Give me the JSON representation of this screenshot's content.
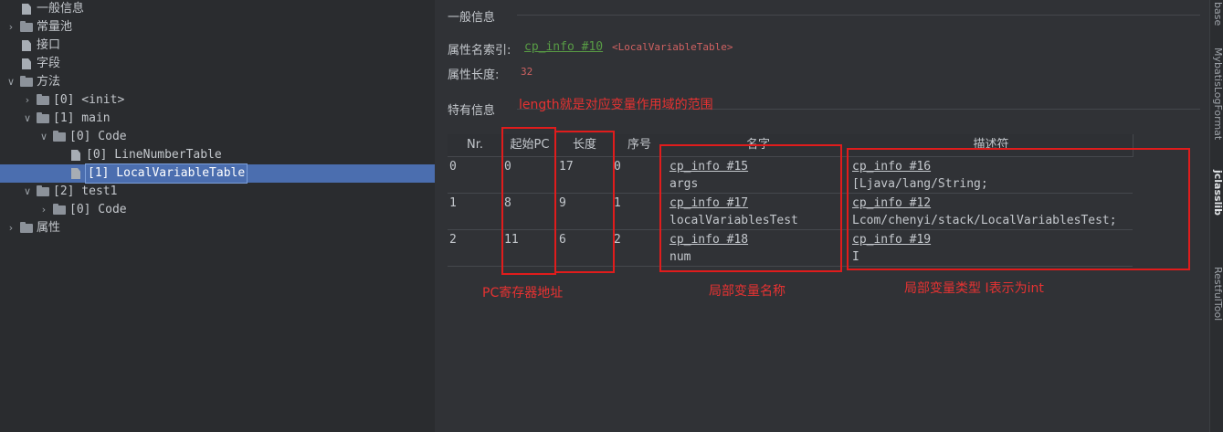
{
  "tree": [
    {
      "label": "一般信息",
      "icon": "file",
      "depth": 0,
      "chev": ""
    },
    {
      "label": "常量池",
      "icon": "folder",
      "depth": 0,
      "chev": "›"
    },
    {
      "label": "接口",
      "icon": "file",
      "depth": 0,
      "chev": ""
    },
    {
      "label": "字段",
      "icon": "file",
      "depth": 0,
      "chev": ""
    },
    {
      "label": "方法",
      "icon": "folder",
      "depth": 0,
      "chev": "⌄"
    },
    {
      "label": "[0] <init>",
      "icon": "folder",
      "depth": 1,
      "chev": "›"
    },
    {
      "label": "[1] main",
      "icon": "folder",
      "depth": 1,
      "chev": "⌄"
    },
    {
      "label": "[0] Code",
      "icon": "folder",
      "depth": 2,
      "chev": "⌄"
    },
    {
      "label": "[0] LineNumberTable",
      "icon": "file",
      "depth": 3,
      "chev": ""
    },
    {
      "label": "[1] LocalVariableTable",
      "icon": "file",
      "depth": 3,
      "chev": "",
      "selected": true
    },
    {
      "label": "[2] test1",
      "icon": "folder",
      "depth": 1,
      "chev": "⌄"
    },
    {
      "label": "[0] Code",
      "icon": "folder",
      "depth": 2,
      "chev": "›"
    },
    {
      "label": "属性",
      "icon": "folder",
      "depth": 0,
      "chev": "›"
    }
  ],
  "general": {
    "title": "一般信息",
    "name_index_label": "属性名索引:",
    "name_index_link": "cp_info #10",
    "name_index_value": "<LocalVariableTable>",
    "length_label": "属性长度:",
    "length_value": "32"
  },
  "specific": {
    "title": "特有信息"
  },
  "table": {
    "headers": [
      "Nr.",
      "起始PC",
      "长度",
      "序号",
      "名字",
      "描述符"
    ],
    "rows": [
      {
        "nr": "0",
        "start_pc": "0",
        "length": "17",
        "index": "0",
        "name_link": "cp_info #15",
        "name": "args",
        "desc_link": "cp_info #16",
        "desc": "[Ljava/lang/String;"
      },
      {
        "nr": "1",
        "start_pc": "8",
        "length": "9",
        "index": "1",
        "name_link": "cp_info #17",
        "name": "localVariablesTest",
        "desc_link": "cp_info #12",
        "desc": "Lcom/chenyi/stack/LocalVariablesTest;"
      },
      {
        "nr": "2",
        "start_pc": "11",
        "length": "6",
        "index": "2",
        "name_link": "cp_info #18",
        "name": "num",
        "desc_link": "cp_info #19",
        "desc": "I"
      }
    ]
  },
  "annotations": {
    "length_note": "length就是对应变量作用域的范围",
    "pc_note": "PC寄存器地址",
    "name_note": "局部变量名称",
    "type_note": "局部变量类型 I表示为int"
  },
  "side_tabs": [
    "base",
    "MybatisLogFormat",
    "jclasslib",
    "RestfulTool"
  ],
  "colors": {
    "link": "#589c45",
    "annotation": "#e63232",
    "selection": "#4b6eaf"
  }
}
